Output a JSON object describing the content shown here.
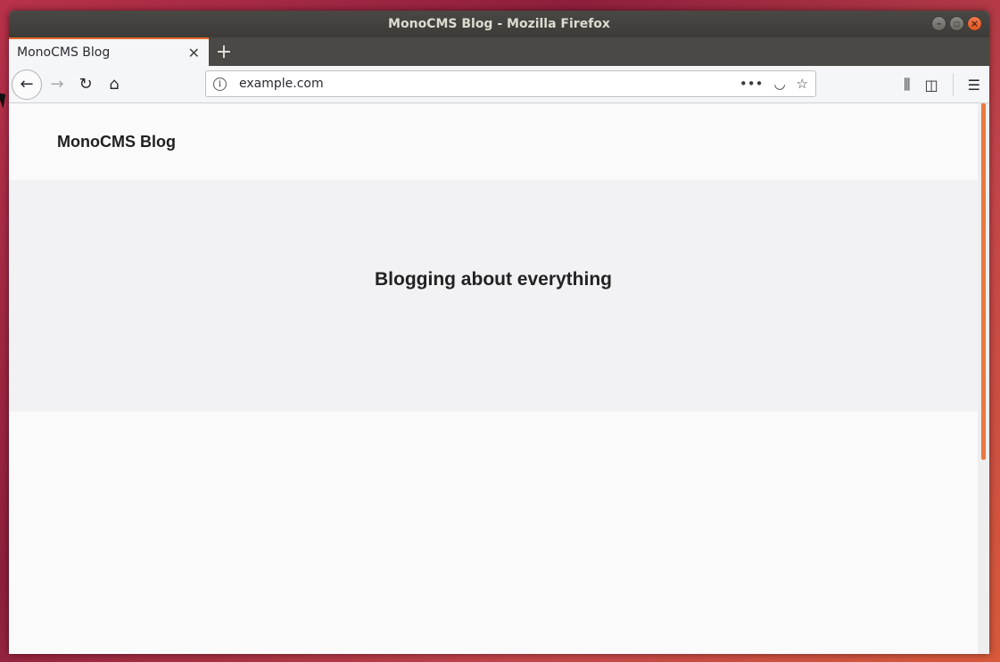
{
  "window": {
    "title": "MonoCMS Blog - Mozilla Firefox"
  },
  "tabs": [
    {
      "label": "MonoCMS Blog"
    }
  ],
  "navbar": {
    "url": "example.com"
  },
  "page": {
    "site_title": "MonoCMS Blog",
    "hero_text": "Blogging about everything"
  },
  "colors": {
    "accent": "#e66c2c",
    "titlebar": "#3c3b37",
    "hero_bg": "#f2f2f4"
  }
}
